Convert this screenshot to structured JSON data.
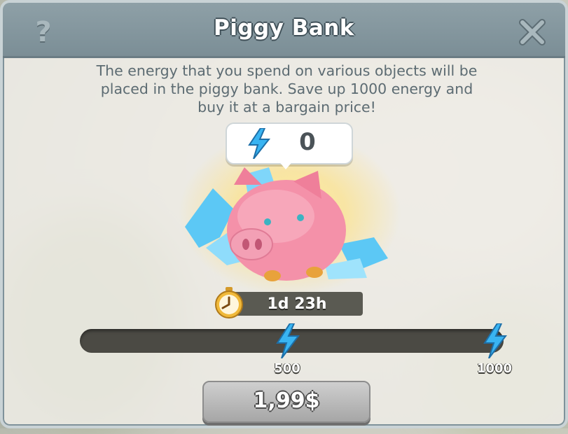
{
  "dialog": {
    "title": "Piggy Bank",
    "help_icon_glyph": "?",
    "description": "The energy that you spend on various objects will be placed in the piggy bank. Save up 1000 energy and buy it at a bargain price!"
  },
  "piggy": {
    "energy_stored": "0",
    "energy_icon": "lightning-icon"
  },
  "timer": {
    "icon": "stopwatch-icon",
    "remaining": "1d 23h"
  },
  "progress": {
    "current": 0,
    "max": 1000,
    "milestones": [
      {
        "value": 500,
        "label": "500"
      },
      {
        "value": 1000,
        "label": "1000"
      }
    ]
  },
  "buy_button": {
    "price": "1,99$"
  },
  "colors": {
    "header": "#7b8e96",
    "energy": "#39b4f2",
    "piggy": "#f28aa4",
    "button": "#b8b8b8"
  }
}
